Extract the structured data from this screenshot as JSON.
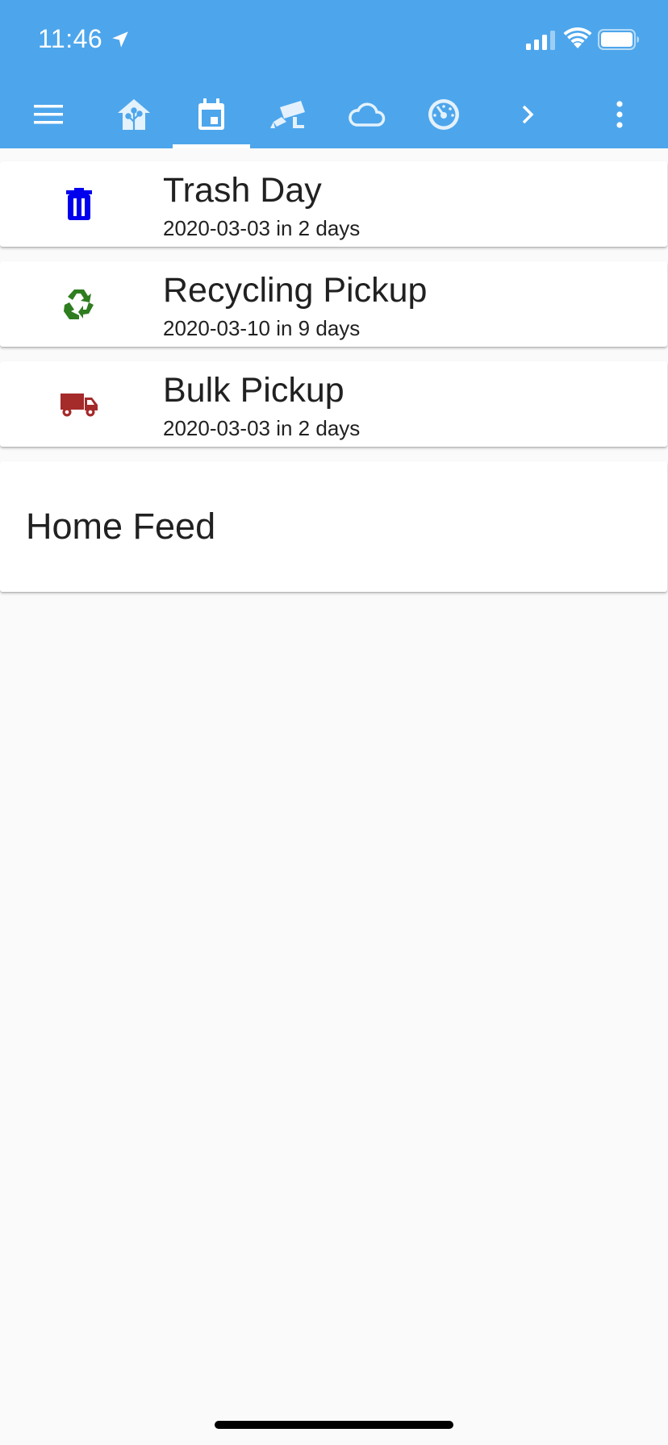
{
  "status_bar": {
    "time": "11:46",
    "icons": [
      "location-arrow-icon",
      "cellular-signal-icon",
      "wifi-icon",
      "battery-icon"
    ]
  },
  "toolbar": {
    "active_tab": "calendar",
    "tabs": [
      {
        "icon": "menu-icon"
      },
      {
        "icon": "home-assistant-icon"
      },
      {
        "icon": "calendar-icon"
      },
      {
        "icon": "security-camera-icon"
      },
      {
        "icon": "cloud-icon"
      },
      {
        "icon": "gauge-icon"
      },
      {
        "icon": "chevron-right-icon"
      },
      {
        "icon": "more-vertical-icon"
      }
    ]
  },
  "colors": {
    "header": "#4da6ec",
    "trash_icon": "#0000ee",
    "recycle_icon": "#2e7d1f",
    "truck_icon": "#a52a2a",
    "background": "#fafafa"
  },
  "pickups": [
    {
      "title": "Trash Day",
      "subtitle": "2020-03-03 in 2 days",
      "icon": "trash-can-icon"
    },
    {
      "title": "Recycling Pickup",
      "subtitle": "2020-03-10 in 9 days",
      "icon": "recycle-icon"
    },
    {
      "title": "Bulk Pickup",
      "subtitle": "2020-03-03 in 2 days",
      "icon": "dump-truck-icon"
    }
  ],
  "feed": {
    "title": "Home Feed"
  }
}
